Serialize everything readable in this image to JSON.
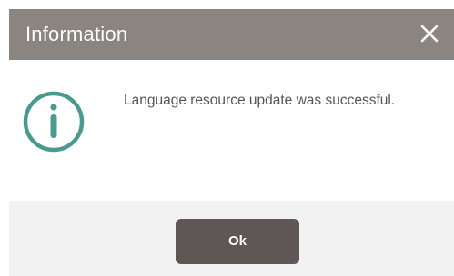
{
  "dialog": {
    "title": "Information",
    "close_icon": "close-icon",
    "icon": "info-circle-icon",
    "message": "Language resource update was successful.",
    "ok_label": "Ok"
  },
  "colors": {
    "titlebar_bg": "#8a8581",
    "icon_color": "#4a9a90",
    "button_bg": "#5f5756",
    "footer_bg": "#f2f2f2",
    "message_text": "#555555"
  }
}
